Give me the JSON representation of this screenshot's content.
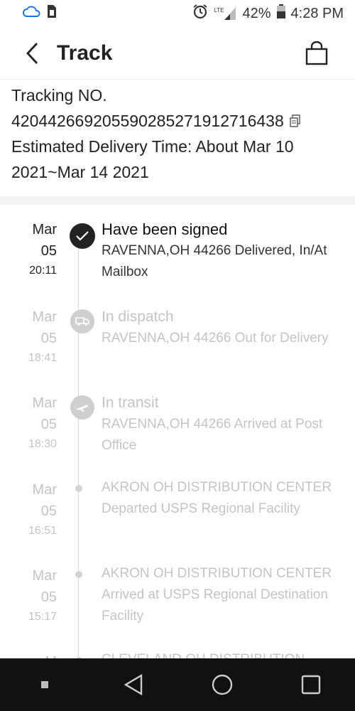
{
  "status_bar": {
    "battery_percent": "42%",
    "time": "4:28 PM",
    "network": "LTE",
    "icons": [
      "cloud-icon",
      "sim-card-icon",
      "alarm-icon",
      "signal-icon",
      "battery-icon"
    ]
  },
  "header": {
    "title": "Track",
    "back_icon": "chevron-left-icon",
    "bag_icon": "shopping-bag-icon"
  },
  "tracking": {
    "label": "Tracking NO.",
    "number": "420442669205590285271912716438",
    "estimate_line1": "Estimated Delivery Time: About Mar 10",
    "estimate_line2": "2021~Mar 14 2021",
    "copy_icon": "copy-icon"
  },
  "events": [
    {
      "month": "Mar",
      "day": "05",
      "time": "20:11",
      "title": "Have been signed",
      "desc": [
        "RAVENNA,OH 44266 Delivered, In/At",
        "Mailbox"
      ],
      "icon": "checkmark-icon"
    },
    {
      "month": "Mar",
      "day": "05",
      "time": "18:41",
      "title": "In dispatch",
      "desc": [
        "RAVENNA,OH 44266 Out for Delivery"
      ],
      "icon": "truck-icon"
    },
    {
      "month": "Mar",
      "day": "05",
      "time": "18:30",
      "title": "In transit",
      "desc": [
        "RAVENNA,OH 44266 Arrived at Post",
        "Office"
      ],
      "icon": "airplane-icon"
    },
    {
      "month": "Mar",
      "day": "05",
      "time": "16:51",
      "title": "",
      "desc": [
        "AKRON OH DISTRIBUTION CENTER",
        "Departed USPS Regional Facility"
      ],
      "icon": "dot-icon"
    },
    {
      "month": "Mar",
      "day": "05",
      "time": "15:17",
      "title": "",
      "desc": [
        "AKRON OH DISTRIBUTION CENTER",
        "Arrived at USPS Regional Destination",
        "Facility"
      ],
      "icon": "dot-icon"
    },
    {
      "month": "M",
      "day": "",
      "time": "",
      "title": "",
      "desc": [
        "CLEVELAND OH DISTRIBUTION"
      ],
      "icon": "dot-icon"
    }
  ],
  "nav": {
    "icons": [
      "recents-dot-icon",
      "back-triangle-icon",
      "home-circle-icon",
      "overview-square-icon"
    ]
  }
}
